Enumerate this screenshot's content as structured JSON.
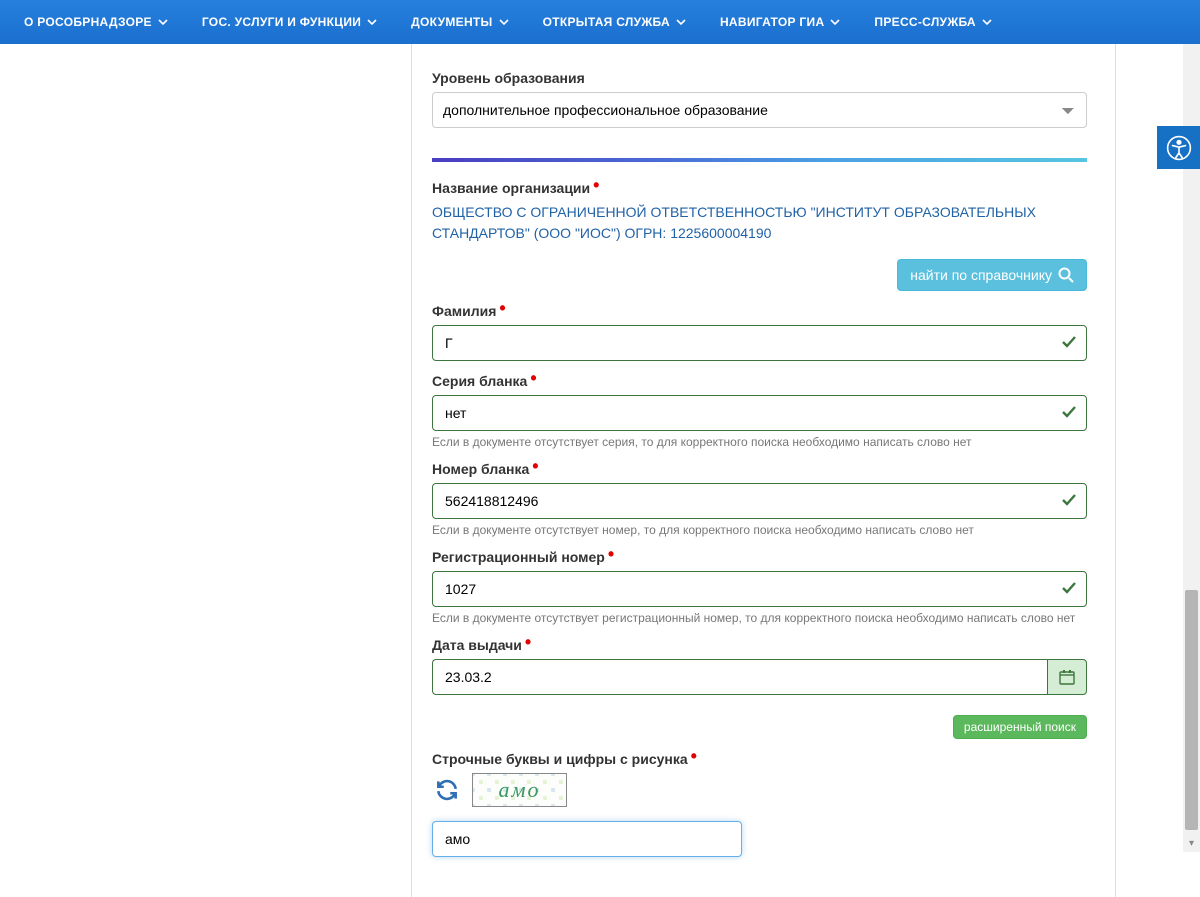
{
  "nav": {
    "items": [
      {
        "label": "О РОСОБРНАДЗОРЕ"
      },
      {
        "label": "ГОС. УСЛУГИ И ФУНКЦИИ"
      },
      {
        "label": "ДОКУМЕНТЫ"
      },
      {
        "label": "ОТКРЫТАЯ СЛУЖБА"
      },
      {
        "label": "НАВИГАТОР ГИА"
      },
      {
        "label": "ПРЕСС-СЛУЖБА"
      }
    ]
  },
  "form": {
    "education_level_label": "Уровень образования",
    "education_level_value": "дополнительное профессиональное образование",
    "org_label": "Название организации",
    "org_value": "ОБЩЕСТВО С ОГРАНИЧЕННОЙ ОТВЕТСТВЕННОСТЬЮ \"ИНСТИТУТ ОБРАЗОВАТЕЛЬНЫХ СТАНДАРТОВ\" (ООО \"ИОС\") ОГРН: 1225600004190",
    "find_in_dictionary": "найти по справочнику",
    "surname_label": "Фамилия",
    "surname_value": "Г            ",
    "series_label": "Серия бланка",
    "series_value": "нет",
    "series_help": "Если в документе отсутствует серия, то для корректного поиска необходимо написать слово нет",
    "number_label": "Номер бланка",
    "number_value": "562418812496",
    "number_help": "Если в документе отсутствует номер, то для корректного поиска необходимо написать слово нет",
    "regnum_label": "Регистрационный номер",
    "regnum_value": "1027       ",
    "regnum_help": "Если в документе отсутствует регистрационный номер, то для корректного поиска необходимо написать слово нет",
    "date_label": "Дата выдачи",
    "date_value": "23.03.2    ",
    "advanced_search": "расширенный поиск",
    "captcha_label": "Строчные буквы и цифры с рисунка",
    "captcha_image_text": "aмo",
    "captcha_value": "амо"
  }
}
